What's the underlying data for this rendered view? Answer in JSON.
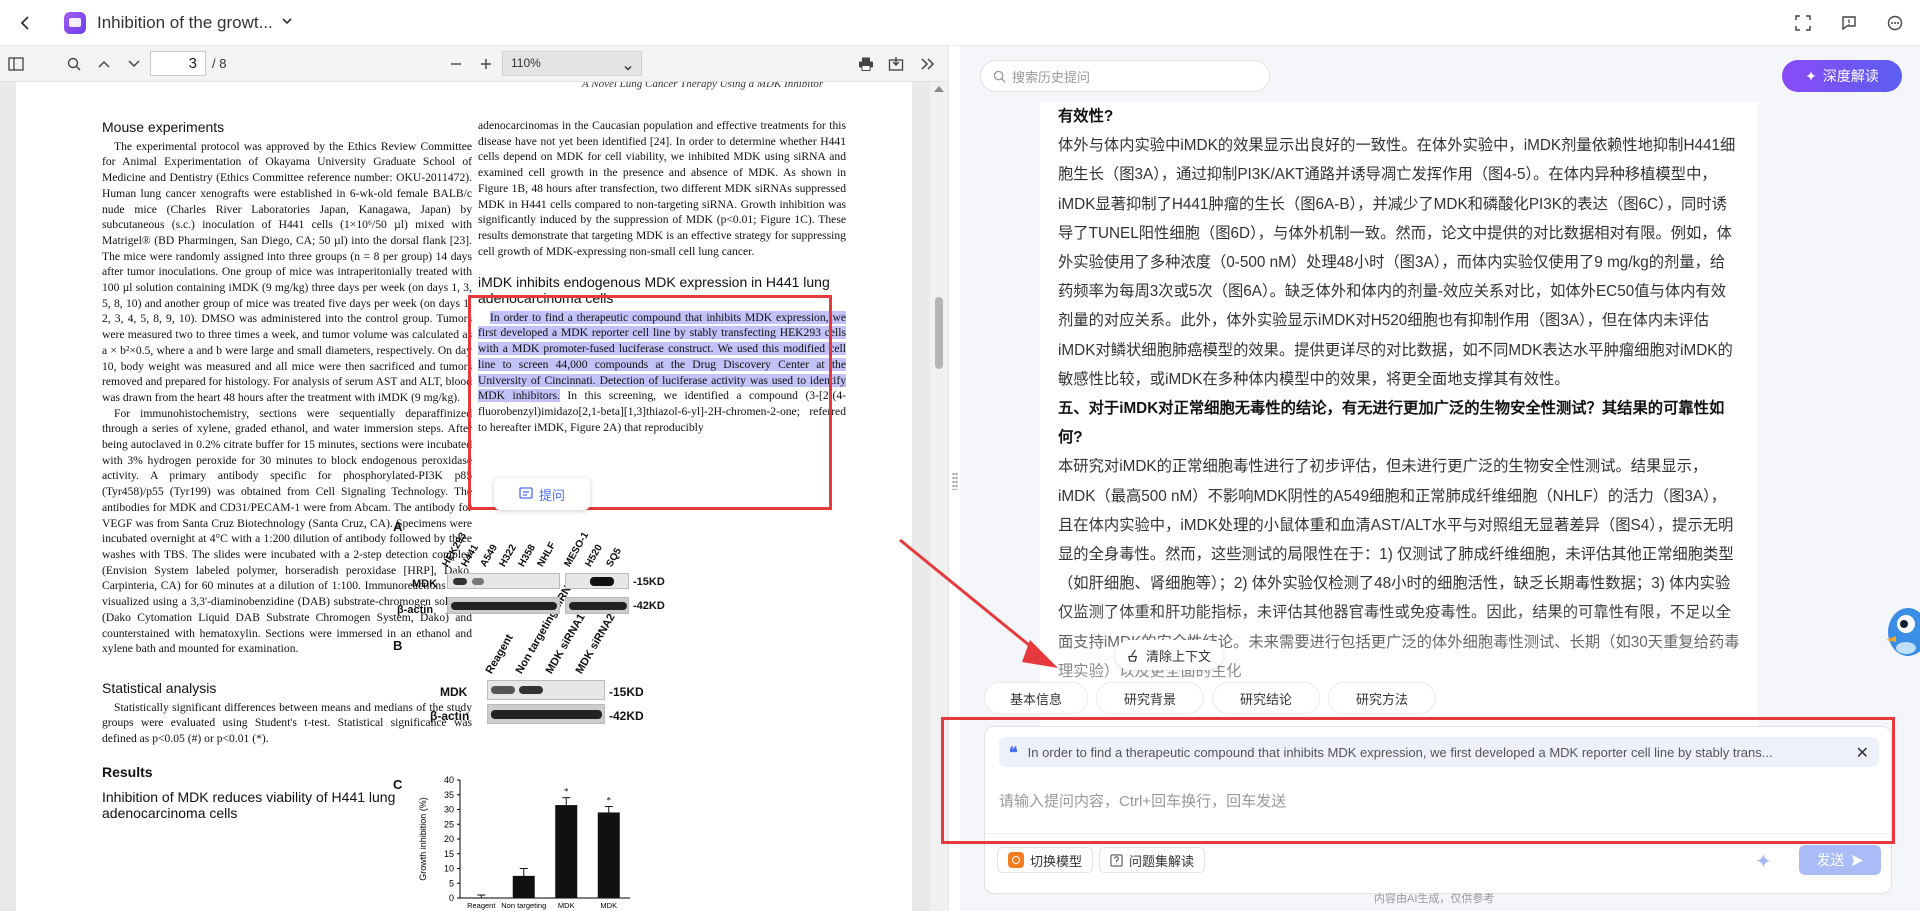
{
  "topbar": {
    "title": "Inhibition of the growt...",
    "icons": [
      "back-icon",
      "app-logo",
      "chevron-down-icon",
      "fullscreen-icon",
      "feedback-icon",
      "more-icon"
    ]
  },
  "pdf_toolbar": {
    "page_current": "3",
    "page_total": "/ 8",
    "zoom": "110%"
  },
  "pdf": {
    "running_head": "A Novel Lung Cancer Therapy Using a MDK Inhibitor",
    "left_col": {
      "h_mouse": "Mouse experiments",
      "p_mouse": "The experimental protocol was approved by the Ethics Review Committee for Animal Experimentation of Okayama University Graduate School of Medicine and Dentistry (Ethics Committee reference number: OKU-2011472). Human lung cancer xenografts were established in 6-wk-old female BALB/c nude mice (Charles River Laboratories Japan, Kanagawa, Japan) by subcutaneous (s.c.) inoculation of H441 cells (1×10⁶/50 µl) mixed with Matrigel® (BD Pharmingen, San Diego, CA; 50 µl) into the dorsal flank [23]. The mice were randomly assigned into three groups (n = 8 per group) 14 days after tumor inoculations. One group of mice was intraperitonially treated with 100 µl solution containing iMDK (9 mg/kg) three days per week (on days 1, 3, 5, 8, 10) and another group of mice was treated five days per week (on days 1, 2, 3, 4, 5, 8, 9, 10). DMSO was administered into the control group. Tumors were measured two to three times a week, and tumor volume was calculated as a × b²×0.5, where a and b were large and small diameters, respectively. On day 10, body weight was measured and all mice were then sacrificed and tumors removed and prepared for histology. For analysis of serum AST and ALT, blood was drawn from the heart 48 hours after the treatment with iMDK (9 mg/kg).",
      "p_ihc": "For immunohistochemistry, sections were sequentially deparaffinized through a series of xylene, graded ethanol, and water immersion steps. After being autoclaved in 0.2% citrate buffer for 15 minutes, sections were incubated with 3% hydrogen peroxide for 30 minutes to block endogenous peroxidase activity. A primary antibody specific for phosphorylated-PI3K p85 (Tyr458)/p55 (Tyr199) was obtained from Cell Signaling Technology. The antibodies for MDK and CD31/PECAM-1 were from Abcam. The antibody for VEGF was from Santa Cruz Biotechnology (Santa Cruz, CA). Specimens were incubated overnight at 4°C with a 1:200 dilution of antibody followed by three washes with TBS. The slides were incubated with a 2-step detection complex (Envision System labeled polymer, horseradish peroxidase [HRP], Dako, Carpinteria, CA) for 60 minutes at a dilution of 1:100. Immunoreactions were visualized using a 3,3'-diaminobenzidine (DAB) substrate-chromogen solution (Dako Cytomation Liquid DAB Substrate Chromogen System, Dako) and counterstained with hematoxylin. Sections were immersed in an ethanol and xylene bath and mounted for examination.",
      "h_stats": "Statistical analysis",
      "p_stats": "Statistically significant differences between means and medians of the study groups were evaluated using Student's t-test. Statistical significance was defined as p<0.05 (#) or p<0.01 (*).",
      "h_results": "Results",
      "h_inhib": "Inhibition of MDK reduces viability of H441 lung adenocarcinoma cells"
    },
    "right_col": {
      "p_top": "adenocarcinomas in the Caucasian population and effective treatments for this disease have not yet been identified [24]. In order to determine whether H441 cells depend on MDK for cell viability, we inhibited MDK using siRNA and examined cell growth in the presence and absence of MDK. As shown in Figure 1B, 48 hours after transfection, two different MDK siRNAs suppressed MDK in H441 cells compared to non-targeting siRNA. Growth inhibition was significantly induced by the suppression of MDK (p<0.01; Figure 1C). These results demonstrate that targeting MDK is an effective strategy for suppressing cell growth of MDK-expressing non-small cell lung cancer.",
      "h_imdk": "iMDK inhibits endogenous MDK expression in H441 lung adenocarcinoma cells",
      "p_hl": "In order to find a therapeutic compound that inhibits MDK expression, we first developed a MDK reporter cell line by stably transfecting HEK293 cells with a MDK promoter-fused luciferase construct. We used this modified cell line to screen 44,000 compounds at the Drug Discovery Center at the University of Cincinnati. Detection of luciferase activity was used to identify MDK inhibitors.",
      "p_after": " In this screening, we identified a compound (3-[2-(4-fluorobenzyl)imidazo[2,1-beta][1,3]thiazol-6-yl]-2H-chromen-2-one; referred to hereafter iMDK, Figure 2A) that reproducibly"
    },
    "ask_button": "提问",
    "figure": {
      "label_a": "A",
      "label_b": "B",
      "label_c": "C",
      "a_lanes_left": [
        "HEK293",
        "H441",
        "A549",
        "H322",
        "H358",
        "NHLF"
      ],
      "a_lanes_right": [
        "MESO-1",
        "H520",
        "SQ5"
      ],
      "a_row1": "MDK",
      "a_row2": "β-actin",
      "kd_15": "-15KD",
      "kd_42": "-42KD",
      "b_lanes": [
        "Reagent",
        "Non targeting siRNA",
        "MDK siRNA1",
        "MDK siRNA2"
      ],
      "b_row1": "MDK",
      "b_row2": "β-actin",
      "c_ylabel": "Growth inhibition (%)",
      "c_yticks": [
        "40",
        "35",
        "30",
        "25",
        "20",
        "15",
        "10",
        "5",
        "0"
      ],
      "c_categories": [
        "Reagent",
        "Non targeting",
        "MDK",
        "MDK"
      ],
      "c_star": "*"
    }
  },
  "chart_data": {
    "type": "bar",
    "ylabel": "Growth inhibition (%)",
    "ylim": [
      0,
      40
    ],
    "categories": [
      "Reagent",
      "Non targeting",
      "MDK",
      "MDK"
    ],
    "values": [
      0,
      7.5,
      31.5,
      29
    ],
    "errors": [
      1,
      2.5,
      2.5,
      2
    ],
    "annotations": [
      "",
      "",
      "*",
      "*"
    ]
  },
  "right_panel": {
    "search_placeholder": "搜索历史提问",
    "deep_button": "深度解读",
    "answer": {
      "l1": "有效性?",
      "l2": "体外与体内实验中iMDK的效果显示出良好的一致性。在体外实验中，iMDK剂量依赖性地抑制H441细胞生长（图3A），通过抑制PI3K/AKT通路并诱导凋亡发挥作用（图4-5）。在体内异种移植模型中，iMDK显著抑制了H441肿瘤的生长（图6A-B），并减少了MDK和磷酸化PI3K的表达（图6C），同时诱导了TUNEL阳性细胞（图6D），与体外机制一致。然而，论文中提供的对比数据相对有限。例如，体外实验使用了多种浓度（0-500 nM）处理48小时（图3A），而体内实验仅使用了9 mg/kg的剂量，给药频率为每周3次或5次（图6A）。缺乏体外和体内的剂量-效应关系对比，如体外EC50值与体内有效剂量的对应关系。此外，体外实验显示iMDK对H520细胞也有抑制作用（图3A），但在体内未评估iMDK对鳞状细胞肺癌模型的效果。提供更详尽的对比数据，如不同MDK表达水平肿瘤细胞对iMDK的敏感性比较，或iMDK在多种体内模型中的效果，将更全面地支撑其有效性。",
      "q5": "五、对于iMDK对正常细胞无毒性的结论，有无进行更加广泛的生物安全性测试？其结果的可靠性如何?",
      "l3": "本研究对iMDK的正常细胞毒性进行了初步评估，但未进行更广泛的生物安全性测试。结果显示，iMDK（最高500 nM）不影响MDK阴性的A549细胞和正常肺成纤维细胞（NHLF）的活力（图3A），且在体内实验中，iMDK处理的小鼠体重和血清AST/ALT水平与对照组无显著差异（图S4），提示无明显的全身毒性。然而，这些测试的局限性在于：1) 仅测试了肺成纤维细胞，未评估其他正常细胞类型（如肝细胞、肾细胞等）；2) 体外实验仅检测了48小时的细胞活性，缺乏长期毒性数据；3) 体内实验仅监测了体重和肝功能指标，未评估其他器官毒性或免疫毒性。因此，结果的可靠性有限，不足以全面支持iMDK的安全性结论。未来需要进行包括更广泛的体外细胞毒性测试、长期（如30天重复给药毒理实验）以及更全面的生化"
    },
    "clear_context": "清除上下文",
    "chips": [
      "基本信息",
      "研究背景",
      "研究结论",
      "研究方法"
    ],
    "quote_text": "In order to find a therapeutic compound that inhibits MDK expression, we first developed a MDK reporter cell line by stably trans...",
    "prompt_placeholder": "请输入提问内容，Ctrl+回车换行，回车发送",
    "switch_model": "切换模型",
    "question_set": "问题集解读",
    "send": "发送",
    "disclaimer": "内容由AI生成，仅供参考"
  }
}
